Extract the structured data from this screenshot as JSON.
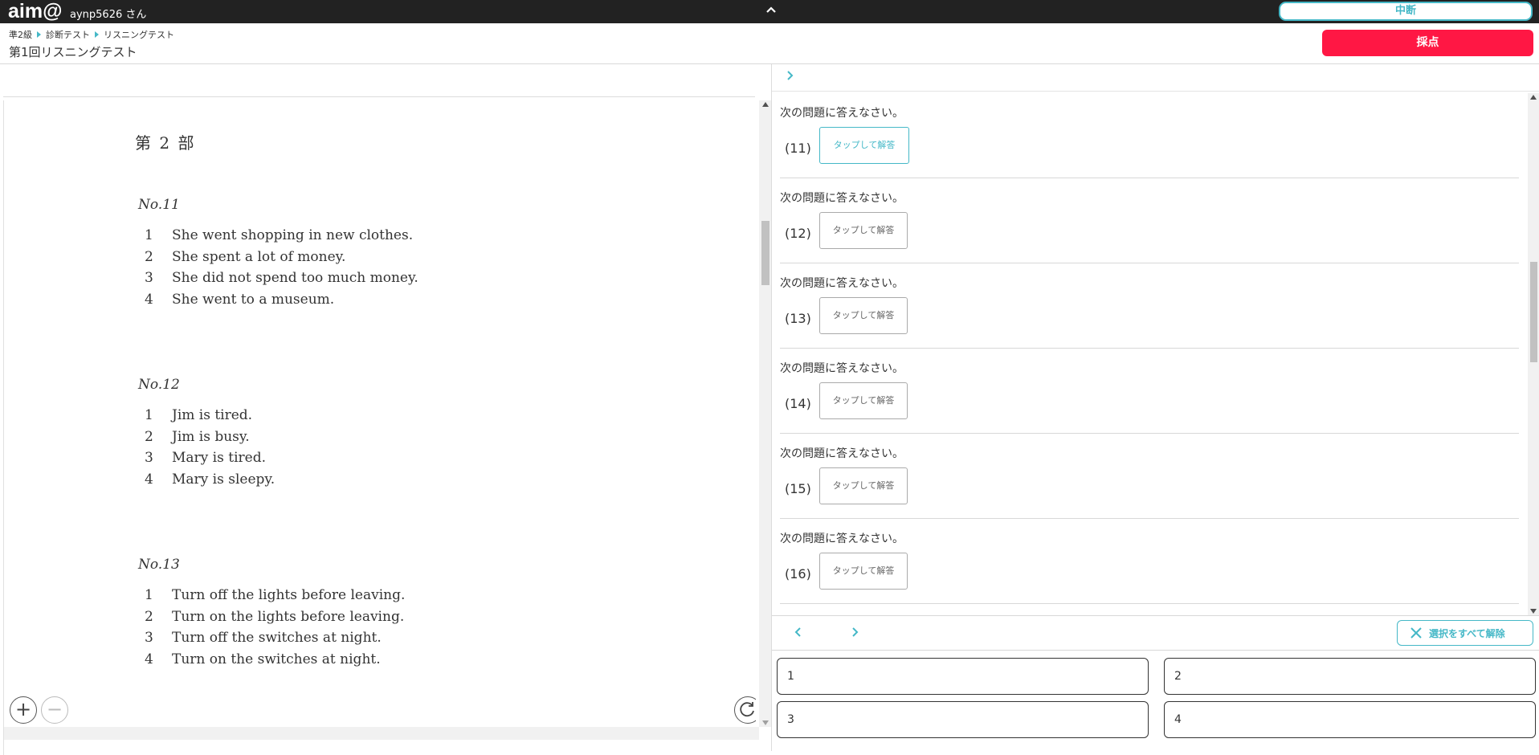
{
  "topbar": {
    "logo": "aim@",
    "username": "aynp5626 さん",
    "suspend_label": "中断"
  },
  "header": {
    "breadcrumb": [
      "準2級",
      "診断テスト",
      "リスニングテスト"
    ],
    "page_title": "第1回リスニングテスト",
    "grade_label": "採点"
  },
  "document": {
    "part_title": "第 2 部",
    "questions": [
      {
        "number": "No.11",
        "options": [
          {
            "n": "1",
            "text": "She went shopping in new clothes."
          },
          {
            "n": "2",
            "text": "She spent a lot of money."
          },
          {
            "n": "3",
            "text": "She did not spend too much money."
          },
          {
            "n": "4",
            "text": "She went to a museum."
          }
        ]
      },
      {
        "number": "No.12",
        "options": [
          {
            "n": "1",
            "text": "Jim is tired."
          },
          {
            "n": "2",
            "text": "Jim is busy."
          },
          {
            "n": "3",
            "text": "Mary is tired."
          },
          {
            "n": "4",
            "text": "Mary is sleepy."
          }
        ]
      },
      {
        "number": "No.13",
        "options": [
          {
            "n": "1",
            "text": "Turn off the lights before leaving."
          },
          {
            "n": "2",
            "text": "Turn on the lights before leaving."
          },
          {
            "n": "3",
            "text": "Turn off the switches at night."
          },
          {
            "n": "4",
            "text": "Turn on the switches at night."
          }
        ]
      }
    ],
    "zoom_in": "+",
    "zoom_out": "−"
  },
  "answers": {
    "items": [
      {
        "prompt": "次の問題に答えなさい。",
        "label": "(11)",
        "button": "タップして解答"
      },
      {
        "prompt": "次の問題に答えなさい。",
        "label": "(12)",
        "button": "タップして解答"
      },
      {
        "prompt": "次の問題に答えなさい。",
        "label": "(13)",
        "button": "タップして解答"
      },
      {
        "prompt": "次の問題に答えなさい。",
        "label": "(14)",
        "button": "タップして解答"
      },
      {
        "prompt": "次の問題に答えなさい。",
        "label": "(15)",
        "button": "タップして解答"
      },
      {
        "prompt": "次の問題に答えなさい。",
        "label": "(16)",
        "button": "タップして解答"
      }
    ],
    "clear_label": "選択をすべて解除",
    "choices": [
      "1",
      "2",
      "3",
      "4"
    ]
  },
  "colors": {
    "accent": "#45b8c7",
    "grade_button": "#ff1744",
    "topbar": "#222222"
  }
}
